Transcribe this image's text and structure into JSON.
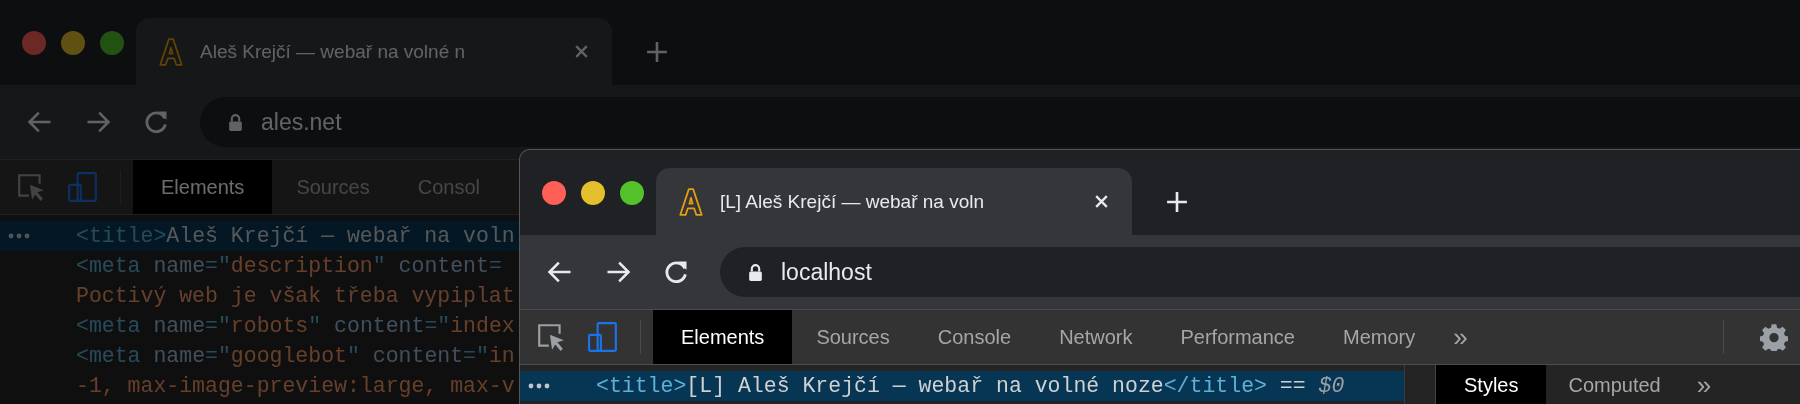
{
  "windows": [
    {
      "dimmed": true,
      "tab": {
        "title": "Aleš Krejčí — webař na volné n"
      },
      "address": "ales.net",
      "devtools_tabs": [
        {
          "label": "Elements",
          "selected": true
        },
        {
          "label": "Sources",
          "selected": false
        },
        {
          "label": "Consol",
          "selected": false
        }
      ],
      "code_lines": [
        {
          "selected": true,
          "segments": [
            {
              "kind": "tag",
              "text": "<title>"
            },
            {
              "kind": "text",
              "text": "Aleš Krejčí — webař na voln"
            }
          ]
        },
        {
          "selected": false,
          "segments": [
            {
              "kind": "tag",
              "text": "<meta "
            },
            {
              "kind": "attr",
              "text": "name"
            },
            {
              "kind": "tag",
              "text": "=\""
            },
            {
              "kind": "value",
              "text": "description"
            },
            {
              "kind": "tag",
              "text": "\" "
            },
            {
              "kind": "attr",
              "text": "content"
            },
            {
              "kind": "tag",
              "text": "="
            }
          ]
        },
        {
          "selected": false,
          "segments": [
            {
              "kind": "value",
              "text": "Poctivý web je však třeba vypiplat"
            }
          ]
        },
        {
          "selected": false,
          "segments": [
            {
              "kind": "tag",
              "text": "<meta "
            },
            {
              "kind": "attr",
              "text": "name"
            },
            {
              "kind": "tag",
              "text": "=\""
            },
            {
              "kind": "value",
              "text": "robots"
            },
            {
              "kind": "tag",
              "text": "\" "
            },
            {
              "kind": "attr",
              "text": "content"
            },
            {
              "kind": "tag",
              "text": "=\""
            },
            {
              "kind": "value",
              "text": "index"
            }
          ]
        },
        {
          "selected": false,
          "segments": [
            {
              "kind": "tag",
              "text": "<meta "
            },
            {
              "kind": "attr",
              "text": "name"
            },
            {
              "kind": "tag",
              "text": "=\""
            },
            {
              "kind": "value",
              "text": "googlebot"
            },
            {
              "kind": "tag",
              "text": "\" "
            },
            {
              "kind": "attr",
              "text": "content"
            },
            {
              "kind": "tag",
              "text": "=\""
            },
            {
              "kind": "value",
              "text": "in"
            }
          ]
        },
        {
          "selected": false,
          "segments": [
            {
              "kind": "value",
              "text": "-1, max-image-preview:large, max-v"
            }
          ]
        }
      ]
    },
    {
      "dimmed": false,
      "tab": {
        "title": "[L] Aleš Krejčí — webař na voln"
      },
      "address": "localhost",
      "devtools_tabs": [
        {
          "label": "Elements",
          "selected": true
        },
        {
          "label": "Sources",
          "selected": false
        },
        {
          "label": "Console",
          "selected": false
        },
        {
          "label": "Network",
          "selected": false
        },
        {
          "label": "Performance",
          "selected": false
        },
        {
          "label": "Memory",
          "selected": false
        }
      ],
      "tabs_overflow": "»",
      "code_lines": [
        {
          "selected": true,
          "segments": [
            {
              "kind": "tag",
              "text": "<title>"
            },
            {
              "kind": "text",
              "text": "[L] Aleš Krejčí — webař na volné noze"
            },
            {
              "kind": "tag",
              "text": "</title>"
            },
            {
              "kind": "text",
              "text": " == "
            },
            {
              "kind": "ref",
              "text": "$0"
            }
          ]
        }
      ],
      "sidebar_tabs": [
        {
          "label": "Styles",
          "selected": true
        },
        {
          "label": "Computed",
          "selected": false
        }
      ],
      "sidebar_overflow": "»"
    }
  ]
}
